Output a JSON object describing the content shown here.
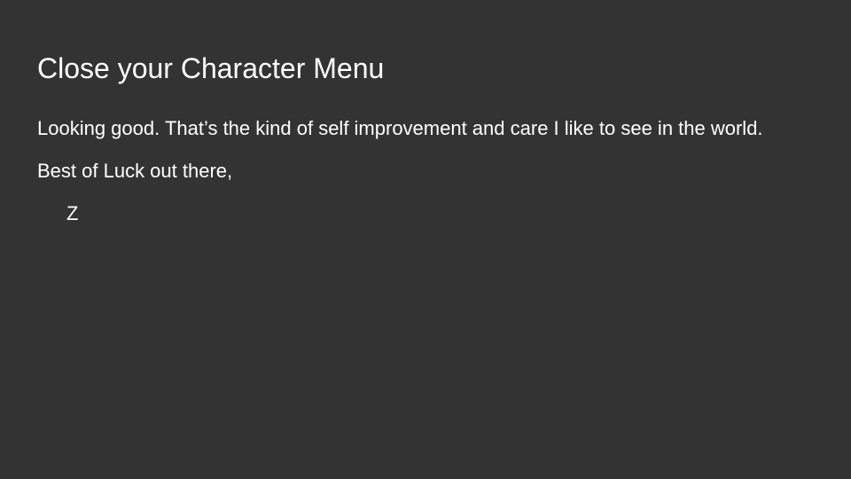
{
  "slide": {
    "title": "Close your Character Menu",
    "paragraphs": [
      "Looking good. That’s the kind of self improvement and care I like to see in the world.",
      "Best of Luck out there,"
    ],
    "signature": "Z",
    "colors": {
      "background": "#333333",
      "text": "#ffffff"
    }
  }
}
